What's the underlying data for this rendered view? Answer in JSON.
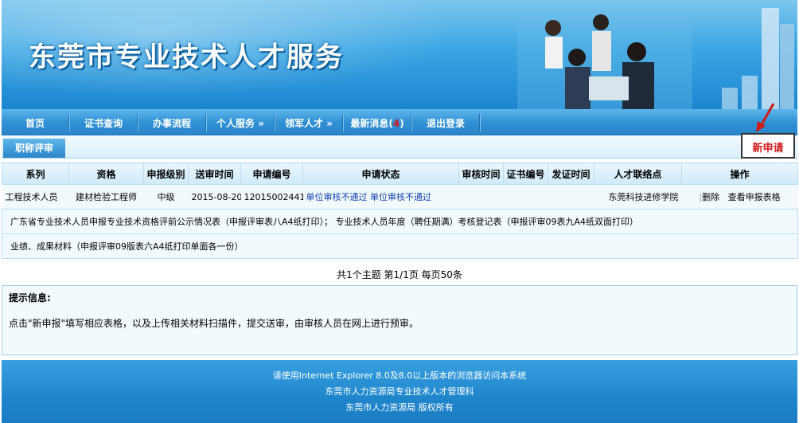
{
  "banner": {
    "title": "东莞市专业技术人才服务"
  },
  "nav": [
    {
      "label": "首页"
    },
    {
      "label": "证书查询"
    },
    {
      "label": "办事流程"
    },
    {
      "label": "个人服务 »"
    },
    {
      "label": "领军人才 »"
    },
    {
      "label": "最新消息("
    },
    {
      "label": "退出登录"
    }
  ],
  "nav_badge": "4",
  "nav_badge_close": ")",
  "subtab": {
    "label": "职称评审"
  },
  "new_button": {
    "label": "新申请"
  },
  "table": {
    "headers": [
      "系列",
      "资格",
      "申报级别",
      "送审时间",
      "申请编号",
      "申请状态",
      "审核时间",
      "证书编号",
      "发证时间",
      "人才联络点",
      "操作"
    ],
    "row": {
      "series": "工程技术人员",
      "qualification": "建材检验工程师",
      "level": "中级",
      "submit_time": "2015-08-20",
      "app_no": "12015002441",
      "status1": "单位审核不通过",
      "status2": "单位审核不通过",
      "review_time": "",
      "cert_no": "",
      "issue_time": "",
      "contact_point": "东莞科技进修学院",
      "op_delete": "删除",
      "op_view": "查看申报表格"
    },
    "note1": "广东省专业技术人员申报专业技术资格评前公示情况表（申报评审表八A4纸打印）；   专业技术人员年度（聘任期满）考核登记表（申报评审09表九A4纸双面打印）",
    "note2": "业绩、成果材料（申报评审09版表六A4纸打印单面各一份）"
  },
  "pager": {
    "text": "共1个主题  第1/1页  每页50条"
  },
  "tips": {
    "heading": "提示信息:",
    "text": "点击\"新申报\"填写相应表格，以及上传相关材料扫描件，提交送审，由审核人员在网上进行预审。"
  },
  "footer": {
    "line1": "请使用Internet Explorer 8.0及8.0以上版本的浏览器访问本系统",
    "line2": "东莞市人力资源局专业技术人才管理科",
    "line3": "东莞市人力资源局    版权所有"
  },
  "colors": {
    "accent": "#2a86cc",
    "alert": "#d01a1a",
    "link": "#0f3fb0"
  }
}
